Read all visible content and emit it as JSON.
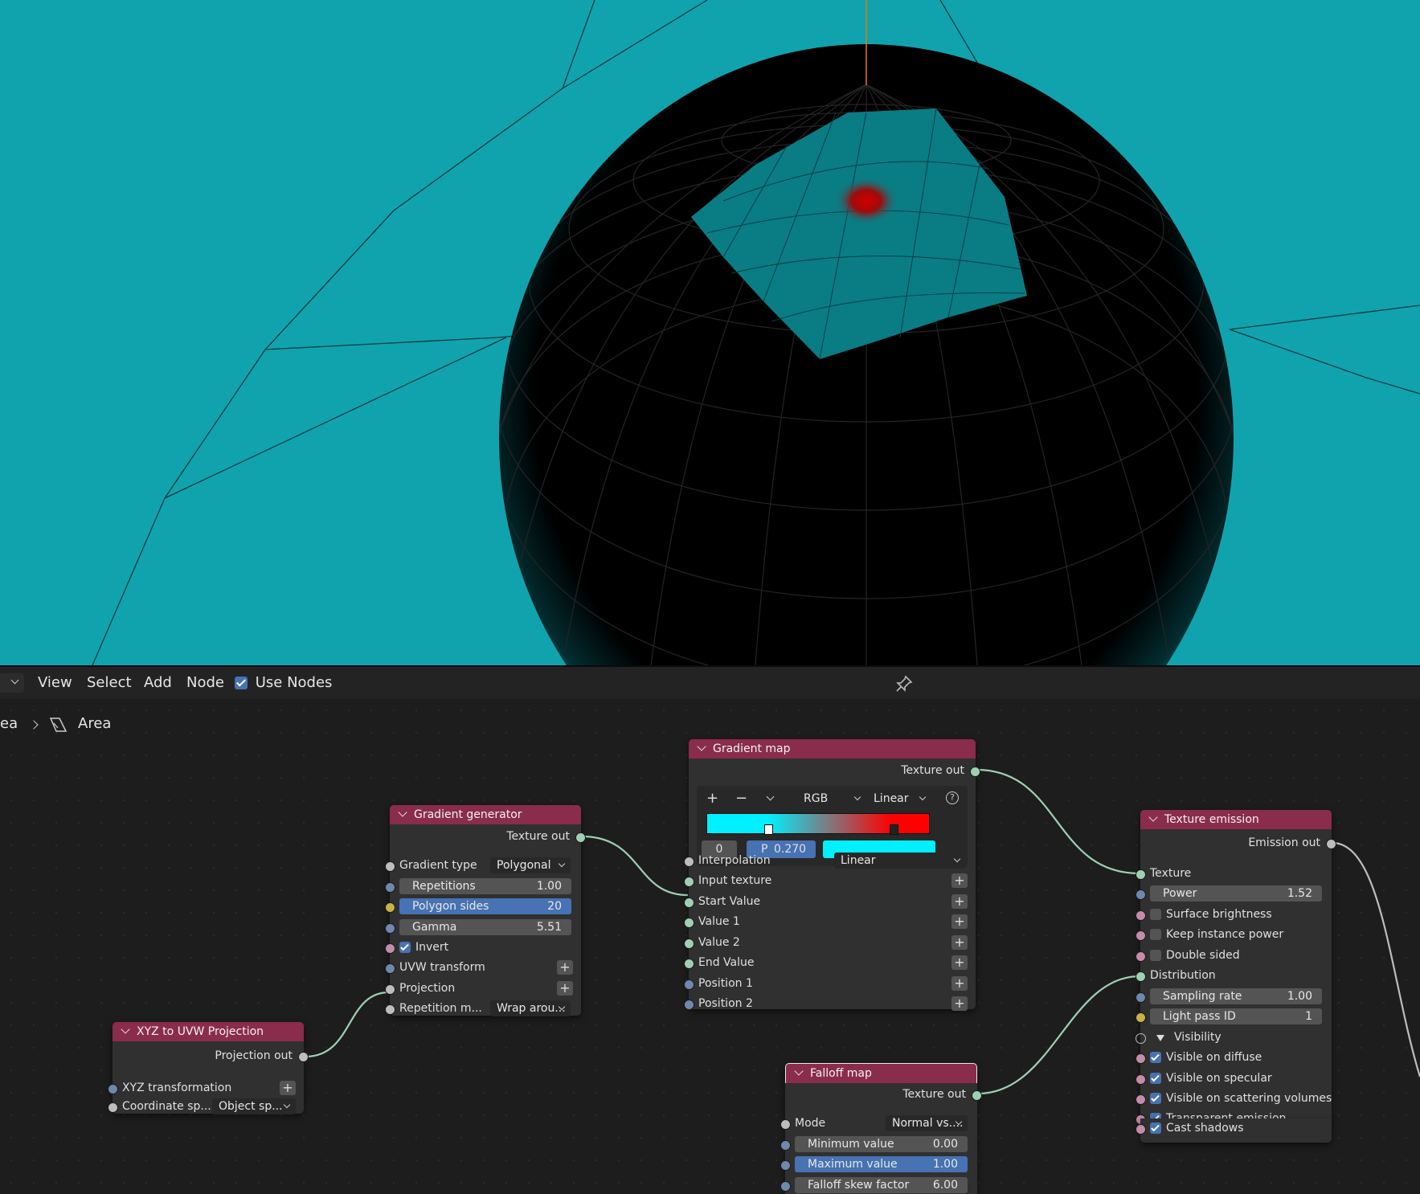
{
  "header": {
    "menu": [
      "View",
      "Select",
      "Add",
      "Node"
    ],
    "use_nodes_label": "Use Nodes",
    "use_nodes_checked": true
  },
  "breadcrumb": {
    "parent": "ea",
    "current": "Area"
  },
  "nodes": {
    "xyz_to_uvw": {
      "title": "XYZ to UVW Projection",
      "output": "Projection out",
      "xyz_transformation": "XYZ transformation",
      "coordinate_space_label": "Coordinate sp...",
      "coordinate_space_value": "Object sp..."
    },
    "gradient_generator": {
      "title": "Gradient generator",
      "output": "Texture out",
      "gradient_type_label": "Gradient type",
      "gradient_type_value": "Polygonal",
      "repetitions_label": "Repetitions",
      "repetitions_value": "1.00",
      "polygon_sides_label": "Polygon sides",
      "polygon_sides_value": "20",
      "gamma_label": "Gamma",
      "gamma_value": "5.51",
      "invert_label": "Invert",
      "invert_checked": true,
      "uvw_transform": "UVW transform",
      "projection": "Projection",
      "repetition_mode_label": "Repetition m...",
      "repetition_mode_value": "Wrap arou..."
    },
    "gradient_map": {
      "title": "Gradient map",
      "output": "Texture out",
      "ramp_mode": "RGB",
      "ramp_interp": "Linear",
      "ramp_index": "0",
      "ramp_pos_label": "P",
      "ramp_pos_value": "0.270",
      "ramp_colors": [
        "#00f0ff",
        "#ff0000"
      ],
      "selected_color": "#00f0ff",
      "interpolation_label": "Interpolation",
      "interpolation_value": "Linear",
      "inputs": [
        "Input texture",
        "Start Value",
        "Value 1",
        "Value 2",
        "End Value",
        "Position 1",
        "Position 2"
      ]
    },
    "falloff_map": {
      "title": "Falloff map",
      "output": "Texture out",
      "mode_label": "Mode",
      "mode_value": "Normal vs....",
      "min_label": "Minimum value",
      "min_value": "0.00",
      "max_label": "Maximum value",
      "max_value": "1.00",
      "skew_label": "Falloff skew factor",
      "skew_value": "6.00"
    },
    "texture_emission": {
      "title": "Texture emission",
      "output": "Emission out",
      "texture": "Texture",
      "power_label": "Power",
      "power_value": "1.52",
      "surface_brightness": "Surface brightness",
      "keep_instance_power": "Keep instance power",
      "double_sided": "Double sided",
      "distribution": "Distribution",
      "sampling_rate_label": "Sampling rate",
      "sampling_rate_value": "1.00",
      "light_pass_id_label": "Light pass ID",
      "light_pass_id_value": "1",
      "visibility": "Visibility",
      "visible_on_diffuse": "Visible on diffuse",
      "visible_on_specular": "Visible on specular",
      "visible_on_scattering": "Visible on scattering volumes",
      "transparent_emission": "Transparent emission",
      "cast_shadows": "Cast shadows"
    }
  },
  "colors": {
    "viewport_bg": "#10a3ad",
    "node_header": "#8a2c4c",
    "selected_field": "#4772b3",
    "socket_green": "#9fd0b4"
  }
}
